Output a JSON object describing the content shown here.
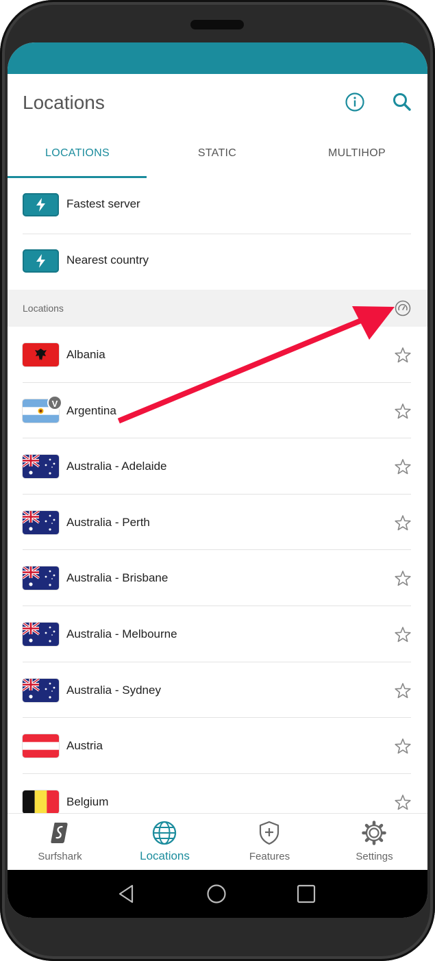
{
  "header": {
    "title": "Locations",
    "info_icon": "info-icon",
    "search_icon": "search-icon"
  },
  "tabs": [
    {
      "label": "LOCATIONS",
      "active": true
    },
    {
      "label": "STATIC",
      "active": false
    },
    {
      "label": "MULTIHOP",
      "active": false
    }
  ],
  "quick_connect": [
    {
      "label": "Fastest server",
      "icon": "lightning-icon"
    },
    {
      "label": "Nearest country",
      "icon": "lightning-icon"
    }
  ],
  "section": {
    "label": "Locations",
    "sort_icon": "sort-speed-icon"
  },
  "locations": [
    {
      "name": "Albania",
      "flag": "albania",
      "badge": ""
    },
    {
      "name": "Argentina",
      "flag": "argentina",
      "badge": "V"
    },
    {
      "name": "Australia - Adelaide",
      "flag": "australia",
      "badge": ""
    },
    {
      "name": "Australia - Perth",
      "flag": "australia",
      "badge": ""
    },
    {
      "name": "Australia - Brisbane",
      "flag": "australia",
      "badge": ""
    },
    {
      "name": "Australia - Melbourne",
      "flag": "australia",
      "badge": ""
    },
    {
      "name": "Australia - Sydney",
      "flag": "australia",
      "badge": ""
    },
    {
      "name": "Austria",
      "flag": "austria",
      "badge": ""
    },
    {
      "name": "Belgium",
      "flag": "belgium",
      "badge": ""
    }
  ],
  "bottom_nav": [
    {
      "label": "Surfshark",
      "icon": "surfshark-logo-icon",
      "active": false
    },
    {
      "label": "Locations",
      "icon": "globe-icon",
      "active": true
    },
    {
      "label": "Features",
      "icon": "shield-plus-icon",
      "active": false
    },
    {
      "label": "Settings",
      "icon": "gear-icon",
      "active": false
    }
  ],
  "colors": {
    "accent": "#1b8c9d",
    "annotation_arrow": "#f0133c"
  }
}
